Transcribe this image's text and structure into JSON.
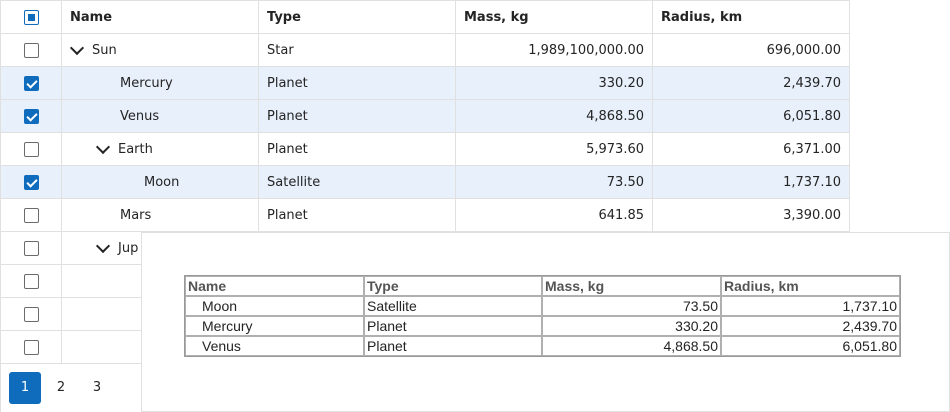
{
  "grid": {
    "columns": [
      "Name",
      "Type",
      "Mass, kg",
      "Radius, km"
    ],
    "rows": [
      {
        "name": "Sun",
        "type": "Star",
        "mass": "1,989,100,000.00",
        "radius": "696,000.00"
      },
      {
        "name": "Mercury",
        "type": "Planet",
        "mass": "330.20",
        "radius": "2,439.70"
      },
      {
        "name": "Venus",
        "type": "Planet",
        "mass": "4,868.50",
        "radius": "6,051.80"
      },
      {
        "name": "Earth",
        "type": "Planet",
        "mass": "5,973.60",
        "radius": "6,371.00"
      },
      {
        "name": "Moon",
        "type": "Satellite",
        "mass": "73.50",
        "radius": "1,737.10"
      },
      {
        "name": "Mars",
        "type": "Planet",
        "mass": "641.85",
        "radius": "3,390.00"
      },
      {
        "name": "Jup",
        "type": "",
        "mass": "",
        "radius": ""
      }
    ],
    "header_checkbox_state": "indeterminate",
    "selected_rows": [
      "Mercury",
      "Venus",
      "Moon"
    ]
  },
  "pager": {
    "pages": [
      "1",
      "2",
      "3"
    ],
    "active": "1"
  },
  "export_preview": {
    "headers": [
      "Name",
      "Type",
      "Mass, kg",
      "Radius, km"
    ],
    "rows": [
      {
        "name": "Moon",
        "type": "Satellite",
        "mass": "73.50",
        "radius": "1,737.10"
      },
      {
        "name": "Mercury",
        "type": "Planet",
        "mass": "330.20",
        "radius": "2,439.70"
      },
      {
        "name": "Venus",
        "type": "Planet",
        "mass": "4,868.50",
        "radius": "6,051.80"
      }
    ]
  },
  "colors": {
    "accent": "#0f6cbd",
    "selected_row": "#e8f0fb",
    "border": "#e0e0e0"
  }
}
